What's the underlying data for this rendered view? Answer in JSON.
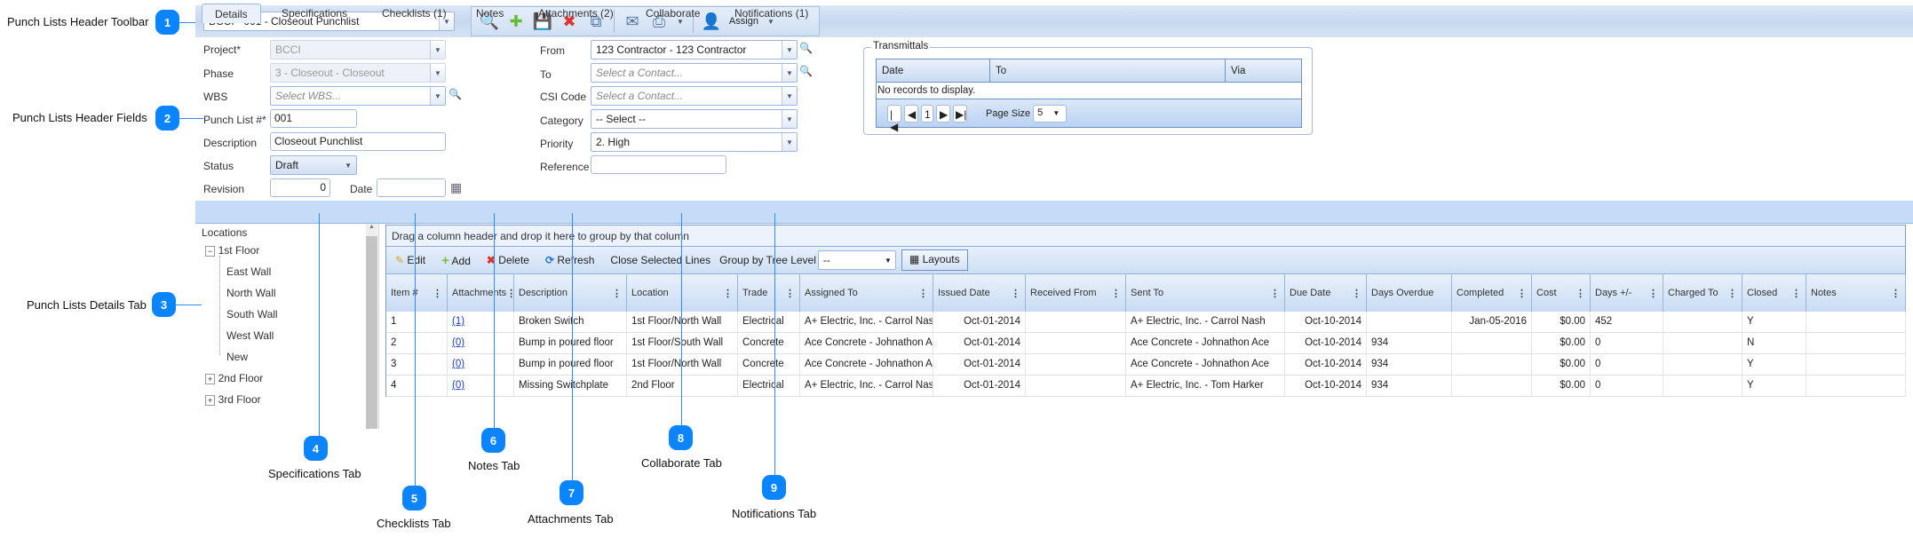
{
  "annotations": [
    {
      "num": "1",
      "label": "Punch Lists Header Toolbar"
    },
    {
      "num": "2",
      "label": "Punch Lists Header Fields"
    },
    {
      "num": "3",
      "label": "Punch Lists Details Tab"
    },
    {
      "num": "4",
      "label": "Specifications Tab"
    },
    {
      "num": "5",
      "label": "Checklists Tab"
    },
    {
      "num": "6",
      "label": "Notes Tab"
    },
    {
      "num": "7",
      "label": "Attachments Tab"
    },
    {
      "num": "8",
      "label": "Collaborate Tab"
    },
    {
      "num": "9",
      "label": "Notifications Tab"
    }
  ],
  "toolbar": {
    "record_select": "BCCI - 001 - Closeout Punchlist",
    "assign_label": "Assign",
    "icons": [
      "search-icon",
      "new-icon",
      "save-icon",
      "delete-icon",
      "copy-icon",
      "email-icon",
      "print-icon",
      "user-icon"
    ]
  },
  "fields": {
    "project": {
      "label": "Project*",
      "value": "BCCI"
    },
    "phase": {
      "label": "Phase",
      "value": "3 - Closeout - Closeout"
    },
    "wbs": {
      "label": "WBS",
      "placeholder": "Select WBS..."
    },
    "punch_list": {
      "label": "Punch List #*",
      "value": "001"
    },
    "description": {
      "label": "Description",
      "value": "Closeout Punchlist"
    },
    "status": {
      "label": "Status",
      "value": "Draft"
    },
    "revision": {
      "label": "Revision",
      "value": "0"
    },
    "date": {
      "label": "Date",
      "value": ""
    },
    "from": {
      "label": "From",
      "value": "123 Contractor - 123 Contractor"
    },
    "to": {
      "label": "To",
      "placeholder": "Select a Contact..."
    },
    "csi_code": {
      "label": "CSI Code",
      "placeholder": "Select a Contact..."
    },
    "category": {
      "label": "Category",
      "value": "-- Select --"
    },
    "priority": {
      "label": "Priority",
      "value": "2. High"
    },
    "reference": {
      "label": "Reference",
      "value": ""
    }
  },
  "transmittals": {
    "title": "Transmittals",
    "columns": [
      "Date",
      "To",
      "Via"
    ],
    "empty": "No records to display.",
    "page": "1",
    "page_size_label": "Page Size",
    "page_size": "5"
  },
  "tabs": [
    "Details",
    "Specifications",
    "Checklists (1)",
    "Notes",
    "Attachments (2)",
    "Collaborate",
    "Notifications (1)"
  ],
  "tree": {
    "title": "Locations",
    "items": [
      "1st Floor",
      "East Wall",
      "North Wall",
      "South Wall",
      "West Wall",
      "New",
      "2nd Floor",
      "3rd Floor"
    ]
  },
  "grid": {
    "group_hint": "Drag a column header and drop it here to group by that column",
    "toolbar": {
      "edit": "Edit",
      "add": "Add",
      "delete": "Delete",
      "refresh": "Refresh",
      "close_lines": "Close Selected Lines",
      "group_label": "Group by Tree Level",
      "group_value": "--",
      "layouts": "Layouts"
    },
    "columns": [
      "Item #",
      "Attachments",
      "Description",
      "Location",
      "Trade",
      "Assigned To",
      "Issued Date",
      "Received From",
      "Sent To",
      "Due Date",
      "Days Overdue",
      "Completed",
      "Cost",
      "Days +/-",
      "Charged To",
      "Closed",
      "Notes"
    ],
    "rows": [
      [
        "1",
        "(1)",
        "Broken Switch",
        "1st Floor/North Wall",
        "Electrical",
        "A+ Electric, Inc. - Carrol Nash",
        "Oct-01-2014",
        "",
        "A+ Electric, Inc. - Carrol Nash",
        "Oct-10-2014",
        "",
        "Jan-05-2016",
        "$0.00",
        "452",
        "",
        "Y",
        ""
      ],
      [
        "2",
        "(0)",
        "Bump in poured floor",
        "1st Floor/South Wall",
        "Concrete",
        "Ace Concrete - Johnathon Ace",
        "Oct-01-2014",
        "",
        "Ace Concrete - Johnathon Ace",
        "Oct-10-2014",
        "934",
        "",
        "$0.00",
        "0",
        "",
        "N",
        ""
      ],
      [
        "3",
        "(0)",
        "Bump in poured floor",
        "1st Floor/North Wall",
        "Concrete",
        "Ace Concrete - Johnathon Ace",
        "Oct-01-2014",
        "",
        "Ace Concrete - Johnathon Ace",
        "Oct-10-2014",
        "934",
        "",
        "$0.00",
        "0",
        "",
        "Y",
        ""
      ],
      [
        "4",
        "(0)",
        "Missing Switchplate",
        "2nd Floor",
        "Electrical",
        "A+ Electric, Inc. - Carrol Nash",
        "Oct-01-2014",
        "",
        "A+ Electric, Inc. - Tom Harker",
        "Oct-10-2014",
        "934",
        "",
        "$0.00",
        "0",
        "",
        "Y",
        ""
      ]
    ]
  },
  "colors": {
    "accent": "#0a84ff",
    "tabbar": "#c5dcf8"
  }
}
